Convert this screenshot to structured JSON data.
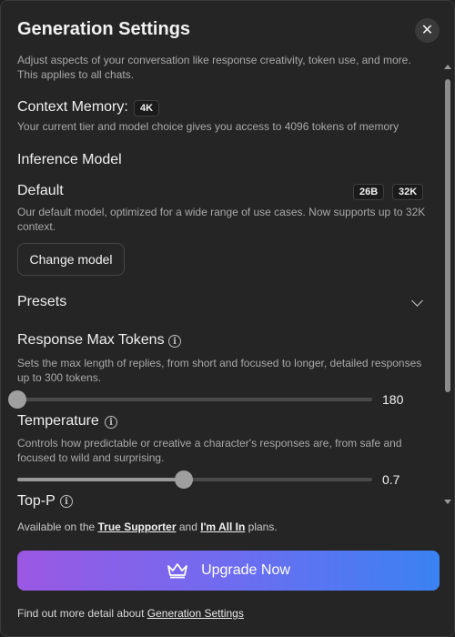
{
  "header": {
    "title": "Generation Settings",
    "description": "Adjust aspects of your conversation like response creativity, token use, and more. This applies to all chats."
  },
  "context_memory": {
    "label": "Context Memory:",
    "badge": "4K",
    "description": "Your current tier and model choice gives you access to 4096 tokens of memory"
  },
  "inference_model": {
    "heading": "Inference Model",
    "model_name": "Default",
    "badges": [
      "26B",
      "32K"
    ],
    "description": "Our default model, optimized for a wide range of use cases. Now supports up to 32K context.",
    "change_button": "Change model"
  },
  "presets": {
    "label": "Presets"
  },
  "response_max_tokens": {
    "label": "Response Max Tokens",
    "description": "Sets the max length of replies, from short and focused to longer, detailed responses up to 300 tokens.",
    "value": "180",
    "slider_fraction": 0.0
  },
  "temperature": {
    "label": "Temperature",
    "description": "Controls how predictable or creative a character's responses are, from safe and focused to wild and surprising.",
    "value": "0.7",
    "slider_fraction": 0.47
  },
  "top_p": {
    "label": "Top-P",
    "availability_prefix": "Available on the ",
    "tier1": "True Supporter",
    "availability_mid": " and ",
    "tier2": "I'm All In",
    "availability_suffix": " plans."
  },
  "upgrade_button": "Upgrade Now",
  "footer": {
    "prefix": "Find out more detail about ",
    "link": "Generation Settings"
  },
  "colors": {
    "background": "#252525",
    "accent_gradient_start": "#9b58e3",
    "accent_gradient_end": "#3a82f2"
  }
}
